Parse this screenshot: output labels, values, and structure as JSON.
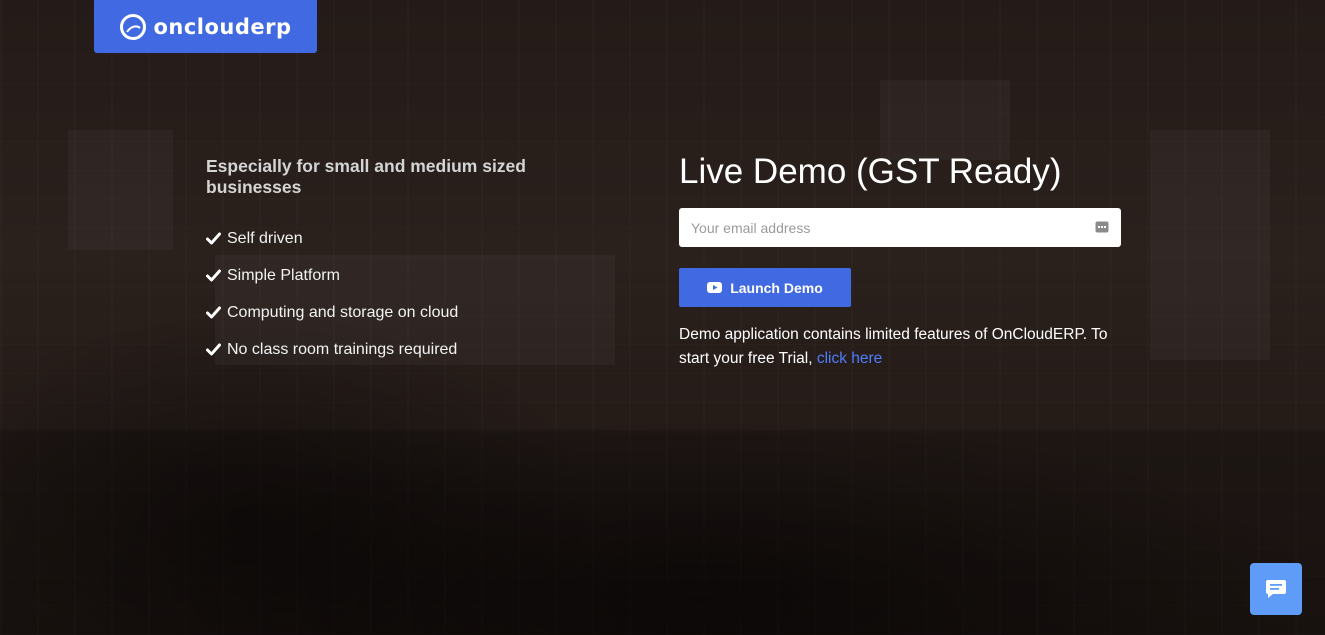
{
  "brand": {
    "name": "onclouderp",
    "color": "#4169e1"
  },
  "features": {
    "heading": "Especially for small and medium sized businesses",
    "items": [
      "Self driven",
      "Simple Platform",
      "Computing and storage on cloud",
      "No class room trainings required"
    ],
    "icon": "check-icon"
  },
  "demo": {
    "title": "Live Demo (GST Ready)",
    "email_placeholder": "Your email address",
    "email_value": "",
    "launch_label": "Launch Demo",
    "launch_icon": "youtube-play-icon",
    "note_text": "Demo application contains limited features of OnCloudERP. To start your free Trial, ",
    "trial_link_text": "click here",
    "link_color": "#4f7dff"
  },
  "chat": {
    "icon": "chat-bubble-icon",
    "color": "#5f9cf7"
  }
}
